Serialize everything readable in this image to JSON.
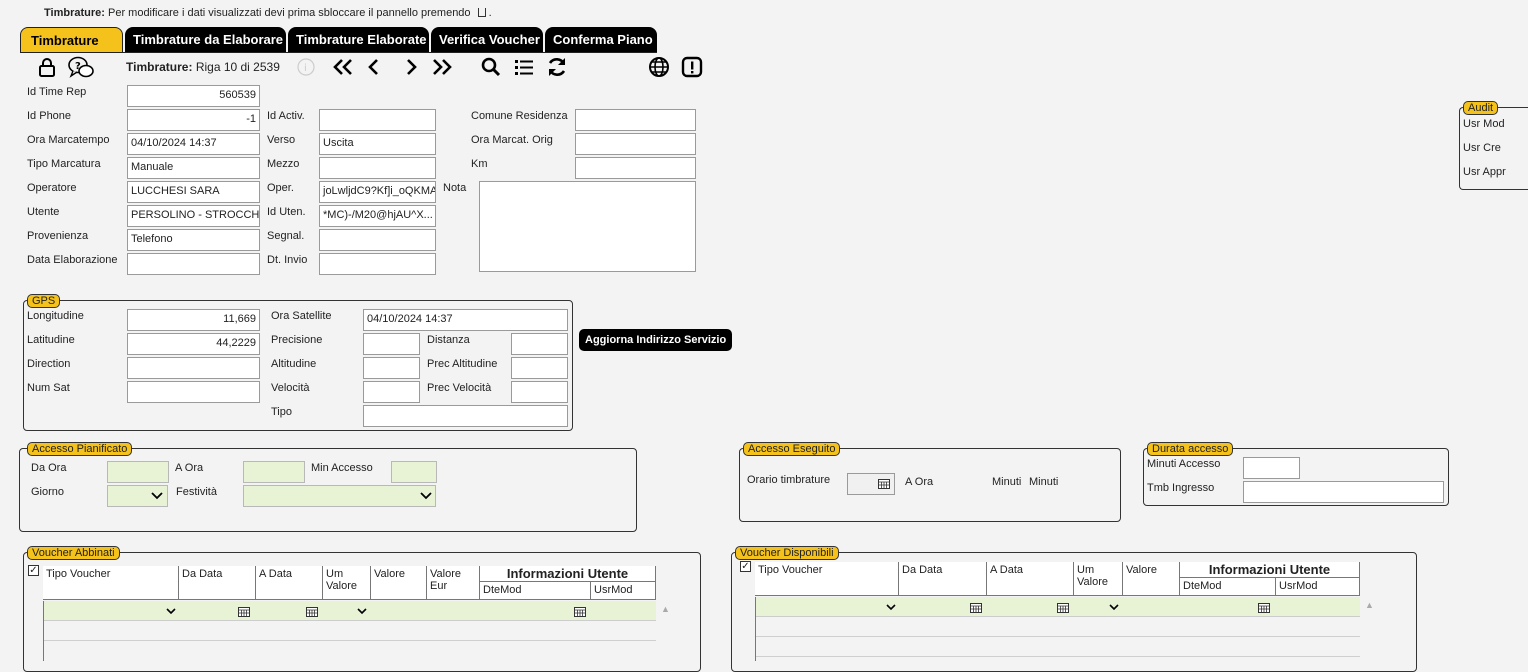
{
  "notice": {
    "bold": "Timbrature:",
    "text": "Per modificare i dati visualizzati devi prima sbloccare il pannello premendo",
    "end": "."
  },
  "tabs": [
    "Timbrature",
    "Timbrature da Elaborare",
    "Timbrature Elaborate",
    "Verifica Voucher",
    "Conferma Piano"
  ],
  "toolbar": {
    "title": "Timbrature:",
    "record": "Riga 10 di 2539"
  },
  "icons": {
    "lock": "lock-icon",
    "help": "help-chat-icon",
    "info": "info-icon",
    "first": "first-page-icon",
    "prev": "prev-icon",
    "next": "next-icon",
    "last": "last-page-icon",
    "search": "search-icon",
    "list": "list-icon",
    "refresh": "refresh-icon",
    "globe": "globe-icon",
    "alert": "alert-icon"
  },
  "colors": {
    "accent": "#f5c21b",
    "tab_bg": "#000000",
    "green_field": "#e8f3d6"
  },
  "main": {
    "id_time_rep": {
      "label": "Id Time Rep",
      "value": "560539"
    },
    "id_phone": {
      "label": "Id Phone",
      "value": "-1"
    },
    "ora_marcatempo": {
      "label": "Ora Marcatempo",
      "value": "04/10/2024 14:37"
    },
    "tipo_marcatura": {
      "label": "Tipo Marcatura",
      "value": "Manuale"
    },
    "operatore": {
      "label": "Operatore",
      "value": "LUCCHESI SARA"
    },
    "utente": {
      "label": "Utente",
      "value": "PERSOLINO - STROCCHI..."
    },
    "provenienza": {
      "label": "Provenienza",
      "value": "Telefono"
    },
    "data_elaborazione": {
      "label": "Data Elaborazione",
      "value": ""
    },
    "id_activ": {
      "label": "Id Activ.",
      "value": ""
    },
    "verso": {
      "label": "Verso",
      "value": "Uscita"
    },
    "mezzo": {
      "label": "Mezzo",
      "value": ""
    },
    "oper": {
      "label": "Oper.",
      "value": "joLwljdC9?Kf]i_oQKMA"
    },
    "id_uten": {
      "label": "Id Uten.",
      "value": "*MC)-/M20@hjAU^X..."
    },
    "segnal": {
      "label": "Segnal.",
      "value": ""
    },
    "dt_invio": {
      "label": "Dt. Invio",
      "value": ""
    },
    "comune_residenza": {
      "label": "Comune Residenza",
      "value": ""
    },
    "ora_marcat_orig": {
      "label": "Ora Marcat. Orig",
      "value": ""
    },
    "km": {
      "label": "Km",
      "value": ""
    },
    "nota": {
      "label": "Nota",
      "value": ""
    }
  },
  "audit": {
    "legend": "Audit",
    "usr_mod": "Usr Mod",
    "usr_cre": "Usr Cre",
    "usr_appr": "Usr Appr"
  },
  "gps": {
    "legend": "GPS",
    "longitudine": {
      "label": "Longitudine",
      "value": "11,669"
    },
    "latitudine": {
      "label": "Latitudine",
      "value": "44,2229"
    },
    "direction": {
      "label": "Direction",
      "value": ""
    },
    "num_sat": {
      "label": "Num Sat",
      "value": ""
    },
    "ora_satellite": {
      "label": "Ora Satellite",
      "value": "04/10/2024 14:37"
    },
    "precisione": {
      "label": "Precisione",
      "value": ""
    },
    "altitudine": {
      "label": "Altitudine",
      "value": ""
    },
    "velocita": {
      "label": "Velocità",
      "value": ""
    },
    "tipo": {
      "label": "Tipo",
      "value": ""
    },
    "distanza": {
      "label": "Distanza",
      "value": ""
    },
    "prec_altitudine": {
      "label": "Prec Altitudine",
      "value": ""
    },
    "prec_velocita": {
      "label": "Prec Velocità",
      "value": ""
    },
    "button": "Aggiorna Indirizzo Servizio"
  },
  "accesso_pianificato": {
    "legend": "Accesso Pianificato",
    "da_ora": "Da Ora",
    "a_ora": "A Ora",
    "min_accesso": "Min Accesso",
    "giorno": "Giorno",
    "festivita": "Festività"
  },
  "accesso_eseguito": {
    "legend": "Accesso Eseguito",
    "orario": "Orario timbrature",
    "a_ora": "A Ora",
    "minuti1": "Minuti",
    "minuti2": "Minuti"
  },
  "durata_accesso": {
    "legend": "Durata accesso",
    "minuti_accesso": "Minuti Accesso",
    "tmb_ingresso": "Tmb Ingresso"
  },
  "voucher_abbinati": {
    "legend": "Voucher Abbinati",
    "columns": [
      "Tipo Voucher",
      "Da Data",
      "A Data",
      "Um Valore",
      "Valore",
      "Valore Eur"
    ],
    "info_header": "Informazioni Utente",
    "info_columns": [
      "DteMod",
      "UsrMod"
    ]
  },
  "voucher_disponibili": {
    "legend": "Voucher Disponibili",
    "columns": [
      "Tipo Voucher",
      "Da Data",
      "A Data",
      "Um Valore",
      "Valore"
    ],
    "info_header": "Informazioni Utente",
    "info_columns": [
      "DteMod",
      "UsrMod"
    ]
  }
}
